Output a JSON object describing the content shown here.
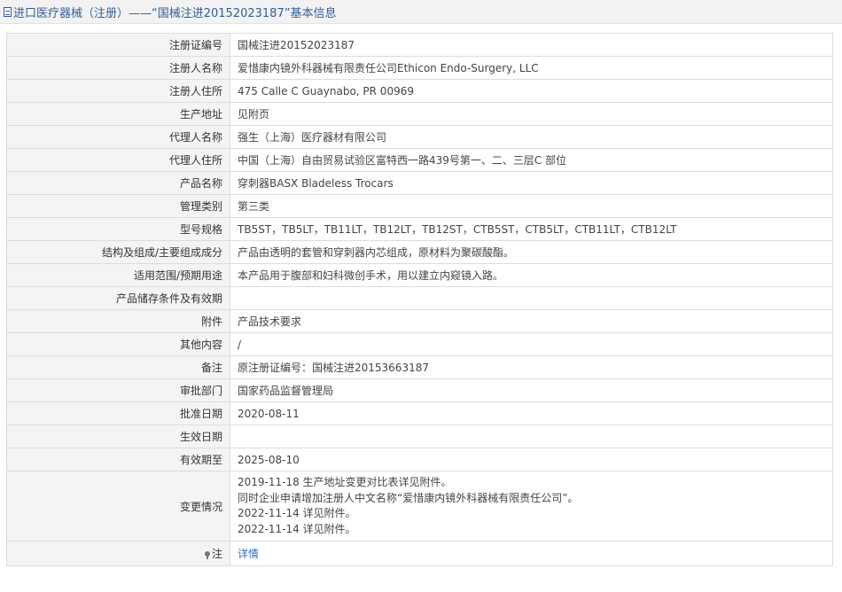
{
  "header": {
    "title": "进口医疗器械（注册）——“国械注进20152023187”基本信息"
  },
  "rows": [
    {
      "label": "注册证编号",
      "value": "国械注进20152023187"
    },
    {
      "label": "注册人名称",
      "value": "爱惜康内镜外科器械有限责任公司Ethicon Endo-Surgery, LLC"
    },
    {
      "label": "注册人住所",
      "value": "475 Calle C Guaynabo, PR 00969"
    },
    {
      "label": "生产地址",
      "value": "见附页"
    },
    {
      "label": "代理人名称",
      "value": "强生（上海）医疗器材有限公司"
    },
    {
      "label": "代理人住所",
      "value": "中国（上海）自由贸易试验区富特西一路439号第一、二、三层C 部位"
    },
    {
      "label": "产品名称",
      "value": "穿刺器BASX Bladeless Trocars"
    },
    {
      "label": "管理类别",
      "value": "第三类"
    },
    {
      "label": "型号规格",
      "value": "TB5ST，TB5LT，TB11LT，TB12LT，TB12ST，CTB5ST，CTB5LT，CTB11LT，CTB12LT"
    },
    {
      "label": "结构及组成/主要组成成分",
      "value": "产品由透明的套管和穿刺器内芯组成，原材料为聚碳酸酯。"
    },
    {
      "label": "适用范围/预期用途",
      "value": "本产品用于腹部和妇科微创手术，用以建立内窥镜入路。"
    },
    {
      "label": "产品储存条件及有效期",
      "value": ""
    },
    {
      "label": "附件",
      "value": "产品技术要求"
    },
    {
      "label": "其他内容",
      "value": "/"
    },
    {
      "label": "备注",
      "value": "原注册证编号：国械注进20153663187"
    },
    {
      "label": "审批部门",
      "value": "国家药品监督管理局"
    },
    {
      "label": "批准日期",
      "value": "2020-08-11"
    },
    {
      "label": "生效日期",
      "value": ""
    },
    {
      "label": "有效期至",
      "value": "2025-08-10"
    }
  ],
  "changes": {
    "label": "变更情况",
    "lines": [
      "2019-11-18 生产地址变更对比表详见附件。",
      "同时企业申请增加注册人中文名称“爱惜康内镜外科器械有限责任公司”。",
      "2022-11-14 详见附件。",
      "2022-11-14 详见附件。"
    ]
  },
  "note": {
    "label": "注",
    "link_text": "详情"
  },
  "icons": {
    "header_icon": "document-icon",
    "note_icon": "pin-icon"
  }
}
